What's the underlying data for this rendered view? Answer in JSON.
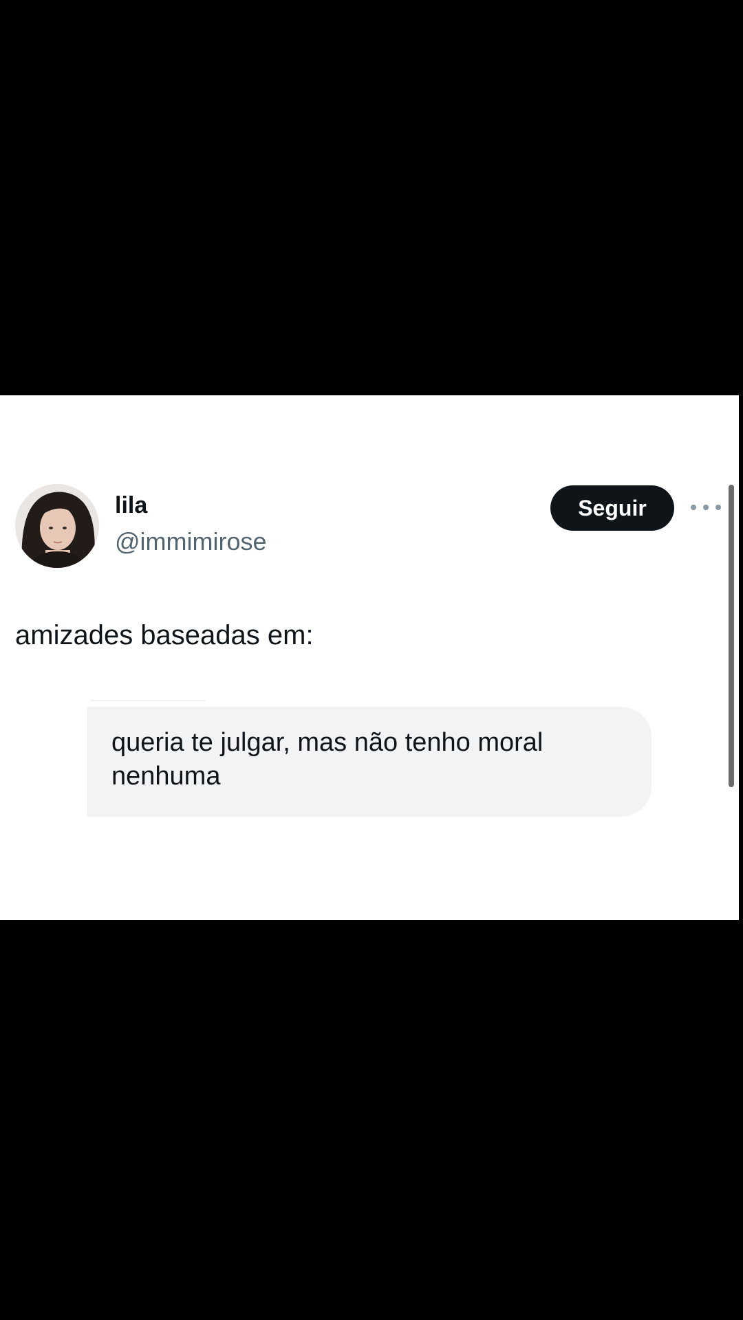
{
  "tweet": {
    "display_name": "lila",
    "handle": "@immimirose",
    "follow_label": "Seguir",
    "text": "amizades baseadas em:",
    "quoted_message": "queria te julgar, mas não tenho moral nenhuma"
  },
  "icons": {
    "more": "more-horizontal-icon",
    "avatar": "profile-photo"
  },
  "colors": {
    "background": "#000000",
    "card": "#ffffff",
    "follow_button": "#0f1419",
    "handle": "#536471",
    "bubble": "#f1f3f5"
  }
}
